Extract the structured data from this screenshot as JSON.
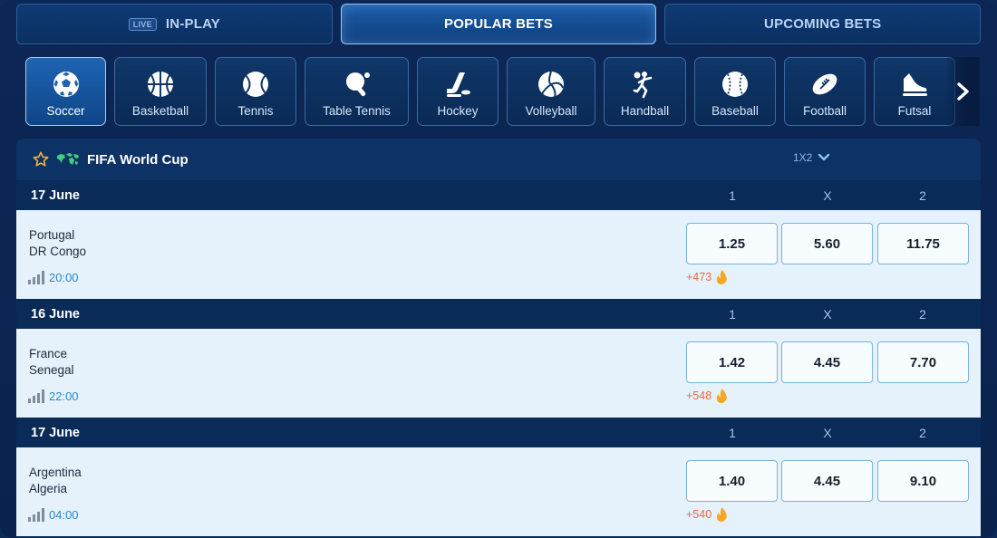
{
  "tabs": [
    {
      "label": "IN-PLAY",
      "badge": "LIVE",
      "active": false
    },
    {
      "label": "POPULAR BETS",
      "active": true
    },
    {
      "label": "UPCOMING BETS",
      "active": false
    }
  ],
  "sports": [
    {
      "label": "Soccer",
      "icon": "soccer-ball-icon",
      "active": true
    },
    {
      "label": "Basketball",
      "icon": "basketball-icon"
    },
    {
      "label": "Tennis",
      "icon": "tennis-ball-icon"
    },
    {
      "label": "Table Tennis",
      "icon": "table-tennis-icon"
    },
    {
      "label": "Hockey",
      "icon": "hockey-icon"
    },
    {
      "label": "Volleyball",
      "icon": "volleyball-icon"
    },
    {
      "label": "Handball",
      "icon": "handball-icon"
    },
    {
      "label": "Baseball",
      "icon": "baseball-icon"
    },
    {
      "label": "Football",
      "icon": "american-football-icon"
    },
    {
      "label": "Futsal",
      "icon": "futsal-shoe-icon"
    }
  ],
  "competition": {
    "title": "FIFA World Cup",
    "market": "1X2",
    "columns": [
      "1",
      "X",
      "2"
    ]
  },
  "matches": [
    {
      "date": "17 June",
      "home": "Portugal",
      "away": "DR Congo",
      "time": "20:00",
      "odds": [
        "1.25",
        "5.60",
        "11.75"
      ],
      "more": "+473"
    },
    {
      "date": "16 June",
      "home": "France",
      "away": "Senegal",
      "time": "22:00",
      "odds": [
        "1.42",
        "4.45",
        "7.70"
      ],
      "more": "+548"
    },
    {
      "date": "17 June",
      "home": "Argentina",
      "away": "Algeria",
      "time": "04:00",
      "odds": [
        "1.40",
        "4.45",
        "9.10"
      ],
      "more": "+540"
    }
  ],
  "colors": {
    "accent": "#1e64b2",
    "background": "#0a2a58",
    "odds_border": "#79b2d8",
    "more_markets": "#e86a3f",
    "time": "#2f87c4"
  }
}
